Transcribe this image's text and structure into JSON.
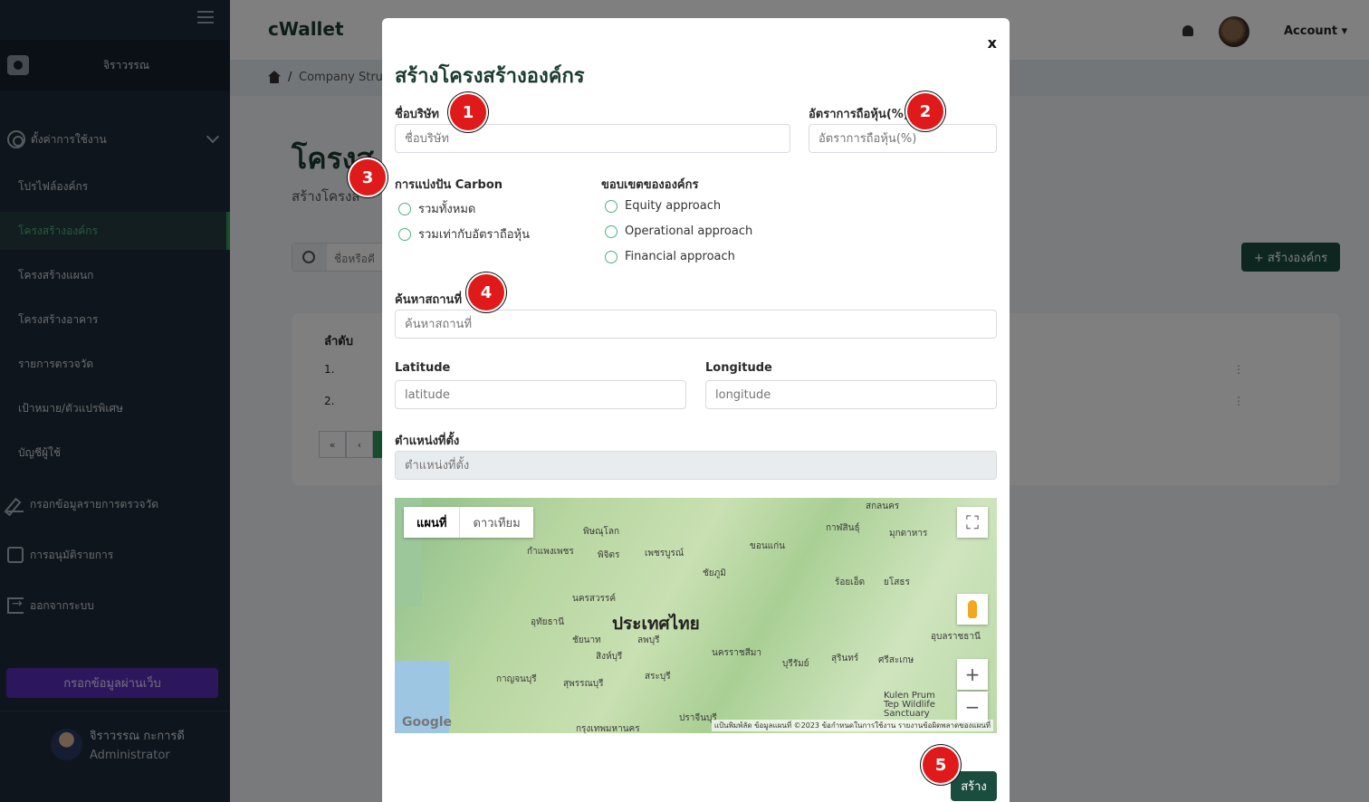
{
  "sidebar": {
    "org_name": "จิราวรรณ",
    "settings_label": "ตั้งค่าการใช้งาน",
    "items": [
      {
        "label": "โปรไฟล์องค์กร"
      },
      {
        "label": "โครงสร้างองค์กร",
        "active": true
      },
      {
        "label": "โครงสร้างแผนก"
      },
      {
        "label": "โครงสร้างอาคาร"
      },
      {
        "label": "รายการตรวจวัด"
      },
      {
        "label": "เป้าหมาย/ตัวแปรพิเศษ"
      },
      {
        "label": "บัญชีผู้ใช้"
      }
    ],
    "actions": [
      {
        "label": "กรอกข้อมูลรายการตรวจวัด",
        "icon": "pencil-icon"
      },
      {
        "label": "การอนุมัติรายการ",
        "icon": "approval-icon"
      },
      {
        "label": "ออกจากระบบ",
        "icon": "logout-icon"
      }
    ],
    "web_entry_button": "กรอกข้อมูลผ่านเว็บ",
    "user": {
      "name": "จิราวรรณ กะการดี",
      "role": "Administrator"
    }
  },
  "topbar": {
    "logo": "cWallet",
    "account": "Account ▾"
  },
  "breadcrumb": {
    "separator": "/",
    "current": "Company Stru"
  },
  "page": {
    "title": "โครงส",
    "subtitle": "สร้างโครงส",
    "search_placeholder": "ชื่อหรือคี",
    "create_button": "+ สร้างองค์กร",
    "table_header": "ลำดับ",
    "rows": [
      "1.",
      "2."
    ],
    "kebab": "⋮",
    "pager": [
      "«",
      "‹"
    ]
  },
  "modal": {
    "close": "x",
    "title": "สร้างโครงสร้างองค์กร",
    "company_name": {
      "label": "ชื่อบริษัท",
      "placeholder": "ชื่อบริษัท"
    },
    "share_ratio": {
      "label": "อัตราการถือหุ้น(%)",
      "placeholder": "อัตราการถือหุ้น(%)"
    },
    "carbon_split": {
      "label": "การแบ่งปัน Carbon",
      "options": [
        "รวมทั้งหมด",
        "รวมเท่ากับอัตราถือหุ้น"
      ]
    },
    "org_boundary": {
      "label": "ขอบเขตขององค์กร",
      "options": [
        "Equity approach",
        "Operational approach",
        "Financial approach"
      ]
    },
    "place_search": {
      "label": "ค้นหาสถานที่",
      "placeholder": "ค้นหาสถานที่"
    },
    "latitude": {
      "label": "Latitude",
      "placeholder": "latitude"
    },
    "longitude": {
      "label": "Longitude",
      "placeholder": "longitude"
    },
    "location": {
      "label": "ตำแหน่งที่ตั้ง",
      "placeholder": "ตำแหน่งที่ตั้ง"
    },
    "map": {
      "tab_map": "แผนที่",
      "tab_satellite": "ดาวเทียม",
      "country": "ประเทศไทย",
      "cities": [
        "พิษณุโลก",
        "นครสวรรค์",
        "อุทัยธานี",
        "ลพบุรี",
        "สระบุรี",
        "กาญจนบุรี",
        "สุพรรณบุรี",
        "นครราชสีมา",
        "บุรีรัมย์",
        "สุรินทร์",
        "ร้อยเอ็ด",
        "ยโสธร",
        "ขอนแก่น",
        "กาฬสินธุ์",
        "อุบลราชธานี",
        "กรุงเทพมหานคร",
        "เพชรบูรณ์",
        "ชัยภูมิ",
        "กำแพงเพชร",
        "พิจิตร",
        "ชัยนาท",
        "สิงห์บุรี",
        "ปราจีนบุรี",
        "ศรีสะเกษ",
        "สกลนคร",
        "มุกดาหาร"
      ],
      "google": "Google",
      "footer": "แป้นพิมพ์ลัด  ข้อมูลแผนที่ ©2023  ข้อกำหนดในการใช้งาน  รายงานข้อผิดพลาดของแผนที่",
      "zoom_in": "+",
      "zoom_out": "−",
      "fullscreen": "⛶",
      "park": "Kulen Prum Tep Wildlife Sanctuary"
    },
    "submit": "สร้าง"
  },
  "badges": [
    "1",
    "2",
    "3",
    "4",
    "5"
  ],
  "colors": {
    "primary": "#1b4d3e",
    "sidebar": "#1f2a38",
    "badge": "#e01a1a",
    "web_button": "#5b2fb8"
  }
}
